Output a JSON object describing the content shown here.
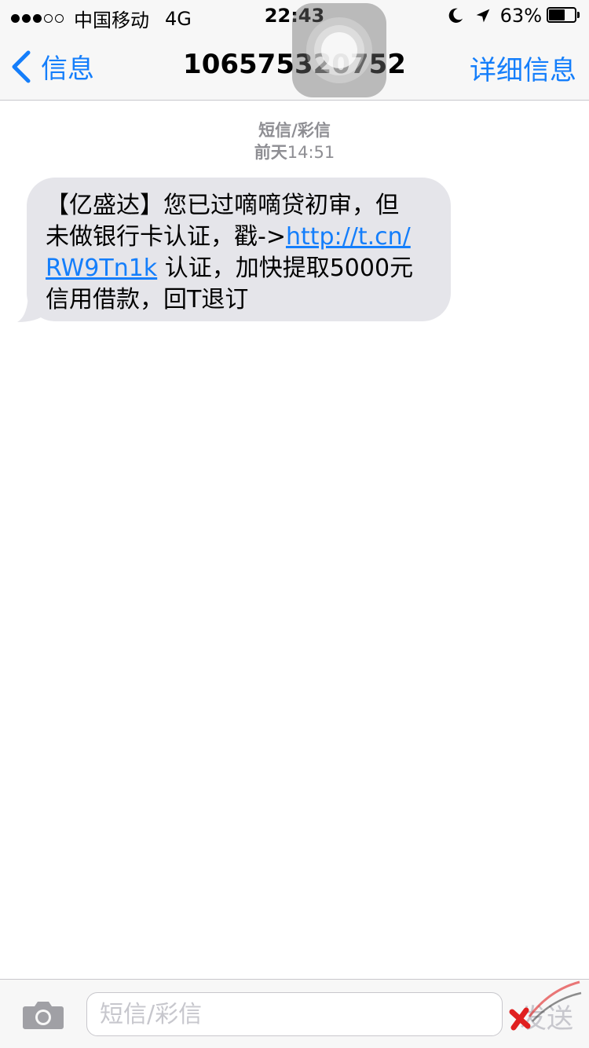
{
  "status_bar": {
    "carrier": "中国移动",
    "network": "4G",
    "time": "22:43",
    "battery_percent": "63%",
    "battery_level": 0.63,
    "signal_bars_filled": 3,
    "signal_bars_total": 5
  },
  "nav": {
    "back_label": "信息",
    "title": "106575320752",
    "details_label": "详细信息"
  },
  "message_meta": {
    "type": "短信/彩信",
    "day": "前天",
    "time": "14:51"
  },
  "message": {
    "line1": "【亿盛达】您已过嘀嘀贷初审，但",
    "line2_text": "未做银行卡认证，戳->",
    "link_part1": "http://t.cn/",
    "link_part2": "RW9Tn1k",
    "line3_rest": " 认证，加快提取5000元",
    "line4": "信用借款，回T退订"
  },
  "input_bar": {
    "placeholder": "短信/彩信",
    "send_label": "发送"
  },
  "colors": {
    "accent": "#147efb",
    "bubble": "#e5e5ea",
    "meta_text": "#8e8e93",
    "bar_bg": "#f7f7f7"
  },
  "icons": {
    "back": "chevron-left-icon",
    "camera": "camera-icon",
    "moon": "moon-icon",
    "location": "location-arrow-icon",
    "battery": "battery-icon"
  }
}
